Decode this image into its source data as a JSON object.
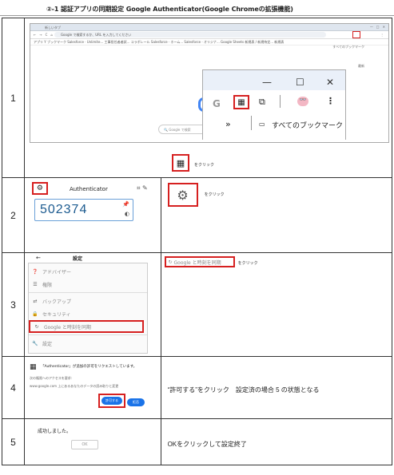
{
  "page_title": "②-1 認証アプリの同期設定 Google Authenticator(Google Chromeの拡張機能)",
  "steps": [
    {
      "number": "1",
      "browser": {
        "tab_title": "新しいタブ",
        "omnibox_placeholder": "Google で検索するか、URL を入力してください",
        "bookmarks": "アプリ  Y ブックマーク  Salesforce · Unlimite...  工事担任者者試...  コラボレール  Salesforce · ホーム...  Salesforce · オリジナ...  Google Sheets  新規表 / 新規待定...  新規表",
        "bookmarks_right": "すべてのブックマーク",
        "search_placeholder": "Google で検索",
        "popup_bookmarks_label": "すべてのブックマーク",
        "popup_chevron": "»",
        "right_label": "最新"
      },
      "instruction": "をクリック"
    },
    {
      "number": "2",
      "app_name": "Authenticator",
      "code": "502374",
      "instruction": "をクリック"
    },
    {
      "number": "3",
      "settings_title": "設定",
      "menu": [
        {
          "icon": "❓",
          "label": "アドバイザー"
        },
        {
          "icon": "☰",
          "label": "権限"
        },
        {
          "icon": "⇄",
          "label": "バックアップ"
        },
        {
          "icon": "🔒",
          "label": "セキュリティ"
        },
        {
          "icon": "↻",
          "label": "Google と時刻を同期"
        },
        {
          "icon": "🔧",
          "label": "設定"
        }
      ],
      "sync_button_label": "Google と時刻を同期",
      "instruction": "をクリック"
    },
    {
      "number": "4",
      "dialog_title": "「Authenticator」が追加の許可をリクエストしています。",
      "dialog_sub1": "次の権限へのアクセスを要求:",
      "dialog_sub2": "www.google.com 上にあるあなたのデータの読み取りと変更",
      "allow_button": "許可する",
      "deny_button": "拒否",
      "instruction": "“許可する”をクリック　設定済の場合 5 の状態となる"
    },
    {
      "number": "5",
      "success_text": "成功しました。",
      "ok_button": "OK",
      "instruction": "OKをクリックして設定終了"
    }
  ],
  "colors": {
    "highlight": "#d62020",
    "code_blue": "#1b5a8f",
    "button_blue": "#1a73e8"
  }
}
